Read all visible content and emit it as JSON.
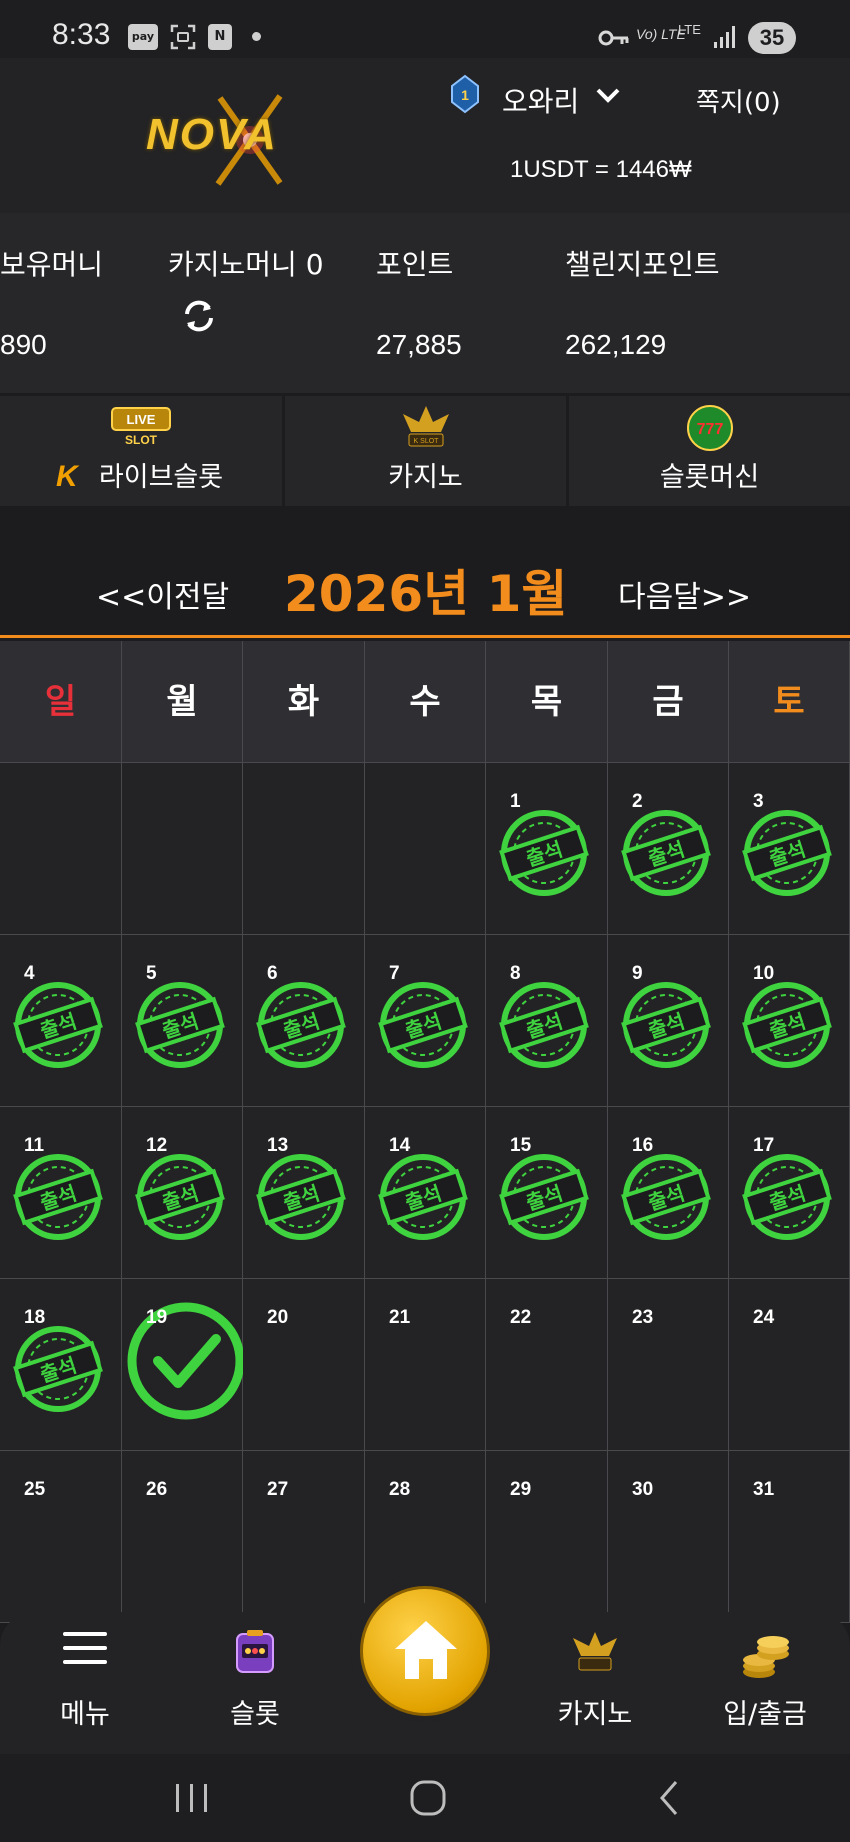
{
  "status_bar": {
    "time": "8:33",
    "icons": [
      "pay-icon",
      "screenshot-icon",
      "n-app-icon"
    ],
    "pay_label": "pay",
    "n_label": "N",
    "volte": "Vo) LTE",
    "lte": "LTE",
    "battery": "35"
  },
  "header": {
    "logo_text": "NOVA",
    "rank": "1",
    "username": "오와리",
    "messages": "쪽지(0)",
    "exchange_rate": "1USDT = 1446₩"
  },
  "balances": {
    "holding_label": "보유머니",
    "holding_value": "890",
    "casino_label": "카지노머니 0",
    "point_label": "포인트",
    "point_value": "27,885",
    "challenge_label": "챌린지포인트",
    "challenge_value": "262,129"
  },
  "tabs": [
    {
      "label": "라이브슬롯",
      "icon": "live-slot-icon"
    },
    {
      "label": "카지노",
      "icon": "casino-icon"
    },
    {
      "label": "슬롯머신",
      "icon": "slot-machine-icon"
    }
  ],
  "tab_extra": {
    "k_mark": "K",
    "live": "LIVE",
    "slot": "SLOT",
    "kslot": "K SLOT"
  },
  "month_nav": {
    "prev": "<<이전달",
    "title": "2026년 1월",
    "next": "다음달>>"
  },
  "weekdays": [
    "일",
    "월",
    "화",
    "수",
    "목",
    "금",
    "토"
  ],
  "weekday_colors": {
    "sunday": "#e8303a",
    "saturday": "#f28c1c",
    "default": "#ffffff"
  },
  "stamp_text": "출석",
  "calendar_days": [
    {
      "day": "",
      "attended": false
    },
    {
      "day": "",
      "attended": false
    },
    {
      "day": "",
      "attended": false
    },
    {
      "day": "",
      "attended": false
    },
    {
      "day": "1",
      "attended": true
    },
    {
      "day": "2",
      "attended": true
    },
    {
      "day": "3",
      "attended": true
    },
    {
      "day": "4",
      "attended": true
    },
    {
      "day": "5",
      "attended": true
    },
    {
      "day": "6",
      "attended": true
    },
    {
      "day": "7",
      "attended": true
    },
    {
      "day": "8",
      "attended": true
    },
    {
      "day": "9",
      "attended": true
    },
    {
      "day": "10",
      "attended": true
    },
    {
      "day": "11",
      "attended": true
    },
    {
      "day": "12",
      "attended": true
    },
    {
      "day": "13",
      "attended": true
    },
    {
      "day": "14",
      "attended": true
    },
    {
      "day": "15",
      "attended": true
    },
    {
      "day": "16",
      "attended": true
    },
    {
      "day": "17",
      "attended": true
    },
    {
      "day": "18",
      "attended": true
    },
    {
      "day": "19",
      "attended": false,
      "today_check": true
    },
    {
      "day": "20",
      "attended": false
    },
    {
      "day": "21",
      "attended": false
    },
    {
      "day": "22",
      "attended": false
    },
    {
      "day": "23",
      "attended": false
    },
    {
      "day": "24",
      "attended": false
    },
    {
      "day": "25",
      "attended": false
    },
    {
      "day": "26",
      "attended": false
    },
    {
      "day": "27",
      "attended": false
    },
    {
      "day": "28",
      "attended": false
    },
    {
      "day": "29",
      "attended": false
    },
    {
      "day": "30",
      "attended": false
    },
    {
      "day": "31",
      "attended": false
    }
  ],
  "bottom_nav": [
    {
      "label": "메뉴",
      "icon": "menu-icon"
    },
    {
      "label": "슬롯",
      "icon": "slot-icon"
    },
    {
      "label": "",
      "icon": "home-icon"
    },
    {
      "label": "카지노",
      "icon": "casino-icon"
    },
    {
      "label": "입/출금",
      "icon": "coins-icon"
    }
  ],
  "colors": {
    "accent": "#f28c1c",
    "stamp_green": "#3fd43f",
    "background": "#1c1c1e"
  }
}
